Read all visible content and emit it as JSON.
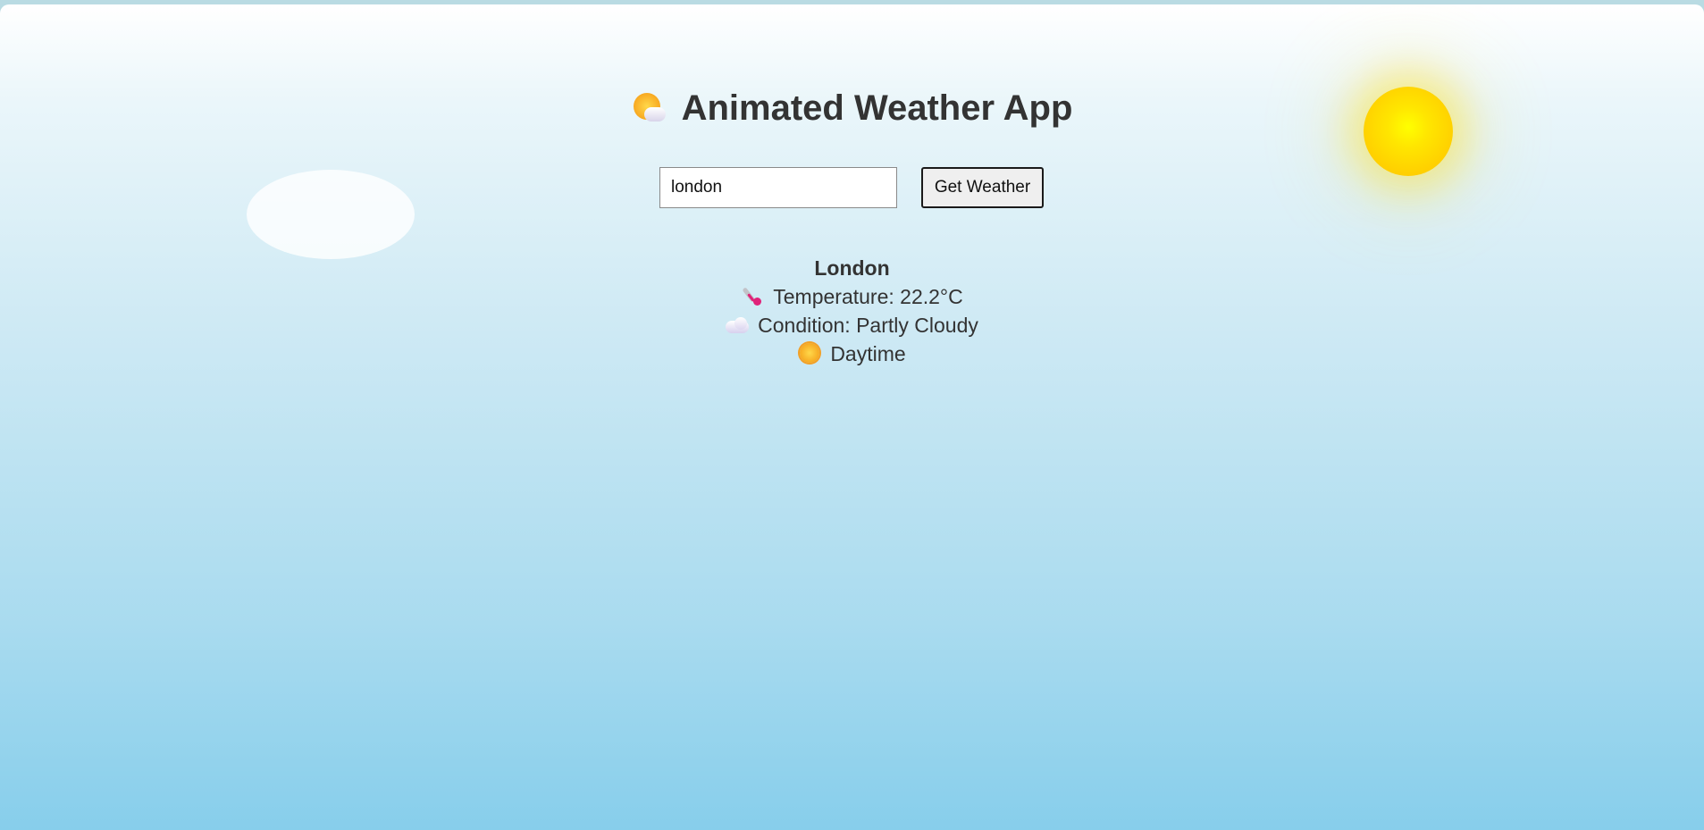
{
  "app": {
    "title": "Animated Weather App",
    "title_icon": "sun-behind-cloud-icon"
  },
  "search": {
    "value": "london",
    "button_label": "Get Weather"
  },
  "weather": {
    "city": "London",
    "temperature_text": "Temperature: 22.2°C",
    "temperature_icon": "thermometer-icon",
    "condition_text": "Condition: Partly Cloudy",
    "condition_icon": "cloud-icon",
    "daytime_text": "Daytime",
    "daytime_icon": "sun-icon"
  },
  "colors": {
    "sky_top": "#ffffff",
    "sky_bottom": "#87ceeb",
    "sun": "#ffd700",
    "text": "#333333"
  }
}
